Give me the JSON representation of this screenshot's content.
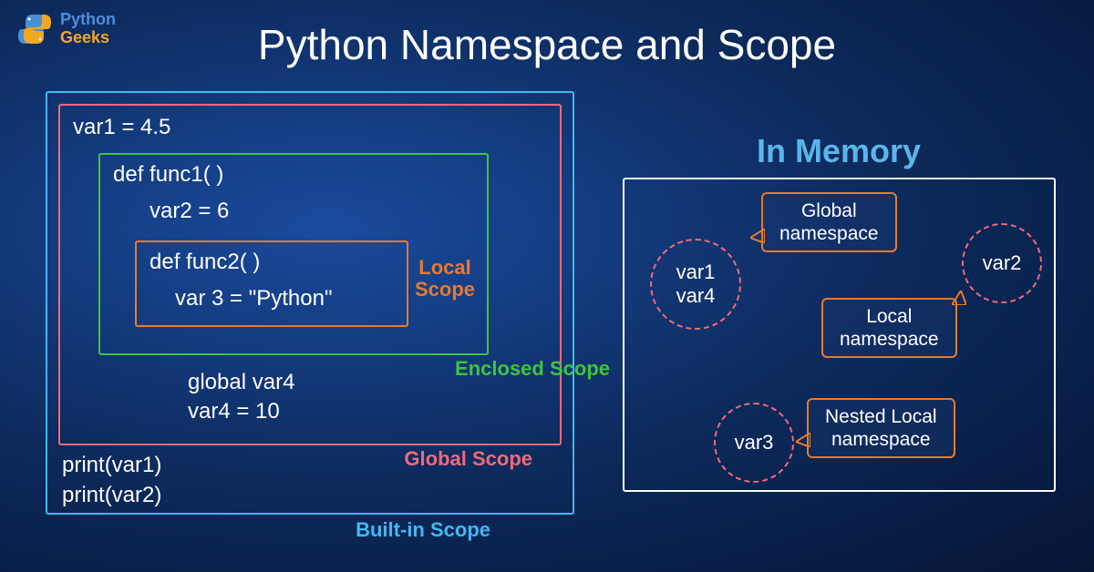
{
  "logo": {
    "line1": "Python",
    "line2": "Geeks"
  },
  "title": "Python Namespace and Scope",
  "scopes": {
    "builtin": "Built-in Scope",
    "global": "Global Scope",
    "enclosed": "Enclosed Scope",
    "local_line1": "Local",
    "local_line2": "Scope"
  },
  "code": {
    "var1": "var1 = 4.5",
    "func1": "def func1( )",
    "var2": "var2 = 6",
    "func2": "def func2( )",
    "var3": "var 3 = \"Python\"",
    "global_var4": "global var4",
    "var4": "var4 = 10",
    "print1": "print(var1)",
    "print2": "print(var2)"
  },
  "memory": {
    "title": "In Memory",
    "circle1_line1": "var1",
    "circle1_line2": "var4",
    "circle2": "var2",
    "circle3": "var3",
    "ns_global_line1": "Global",
    "ns_global_line2": "namespace",
    "ns_local_line1": "Local",
    "ns_local_line2": "namespace",
    "ns_nested_line1": "Nested Local",
    "ns_nested_line2": "namespace"
  }
}
